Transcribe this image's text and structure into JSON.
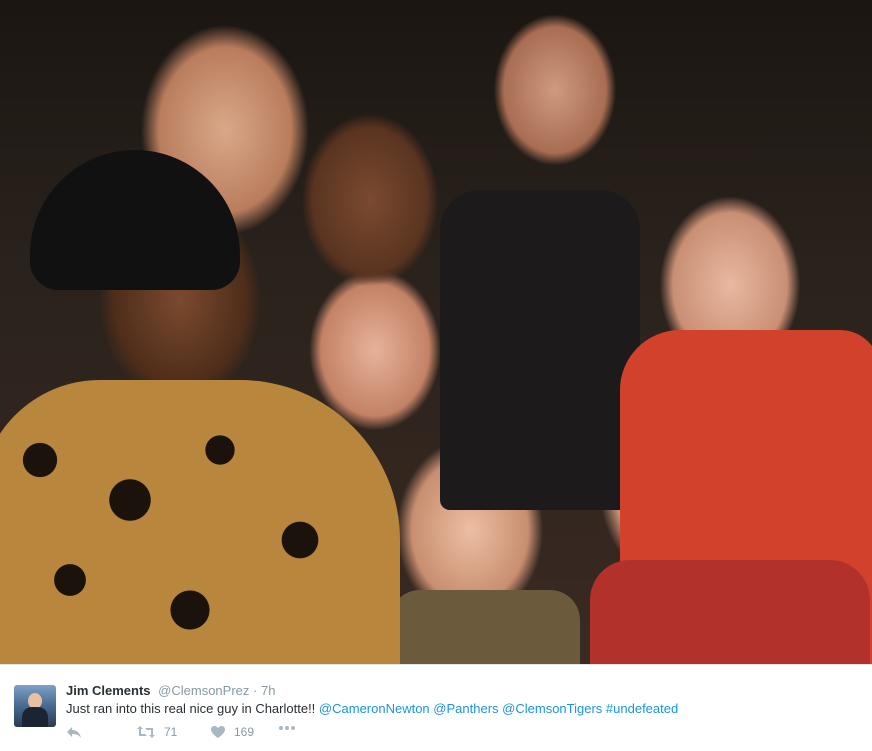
{
  "photo": {
    "alt_subject": "group-selfie"
  },
  "tweet": {
    "author_name": "Jim Clements",
    "handle": "@ClemsonPrez",
    "separator": "·",
    "time": "7h",
    "text": "Just ran into this real nice guy in Charlotte!!",
    "mentions": [
      "@CameronNewton",
      "@Panthers",
      "@ClemsonTigers",
      "#undefeated"
    ],
    "retweet_count": "71",
    "like_count": "169"
  },
  "icons": {
    "reply": "reply-icon",
    "retweet": "retweet-icon",
    "like": "heart-icon",
    "more": "more-icon"
  },
  "colors": {
    "link": "#1b95e0",
    "text": "#292f33",
    "muted": "#8899a6",
    "icon": "#aab8c2"
  }
}
